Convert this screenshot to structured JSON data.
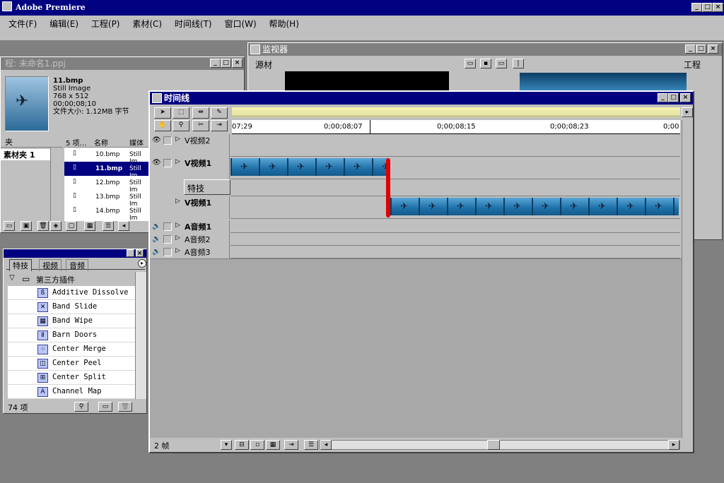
{
  "app": {
    "title": "Adobe Premiere"
  },
  "menu": {
    "items": [
      "文件(F)",
      "编辑(E)",
      "工程(P)",
      "素材(C)",
      "时间线(T)",
      "窗口(W)",
      "帮助(H)"
    ]
  },
  "project": {
    "title": "程: 未命名1.ppj",
    "selected": {
      "name": "11.bmp",
      "type": "Still Image",
      "dims": "768 x 512",
      "duration": "00;00;08;10",
      "size": "文件大小: 1.12MB 字节"
    },
    "bin_header": "夹",
    "bin_name": "素材夹 1",
    "cols": {
      "count": "5 项…",
      "name": "名称",
      "media": "媒体"
    },
    "files": [
      {
        "name": "10.bmp",
        "media": "Still Im"
      },
      {
        "name": "11.bmp",
        "media": "Still Im"
      },
      {
        "name": "12.bmp",
        "media": "Still Im"
      },
      {
        "name": "13.bmp",
        "media": "Still Im"
      },
      {
        "name": "14.bmp",
        "media": "Still Im"
      }
    ]
  },
  "monitor": {
    "title": "监视器",
    "source_label": "源材",
    "program_label": "工程"
  },
  "timeline": {
    "title": "时间线",
    "ruler": [
      "07;29",
      "0;00;08;07",
      "0;00;08;15",
      "0;00;08;23",
      "0;00"
    ],
    "tracks": {
      "v2": "V视频2",
      "v1a": "V视频1",
      "fx": "特技",
      "v1b": "V视频1",
      "a1": "A音频1",
      "a2": "A音频2",
      "a3": "A音频3"
    },
    "footer": "2 帧"
  },
  "effects": {
    "tabs": [
      "特技",
      "视频",
      "音频"
    ],
    "folder": "第三方插件",
    "items": [
      "Additive Dissolve",
      "Band Slide",
      "Band Wipe",
      "Barn Doors",
      "Center Merge",
      "Center Peel",
      "Center Split",
      "Channel Map"
    ],
    "count": "74 项"
  }
}
